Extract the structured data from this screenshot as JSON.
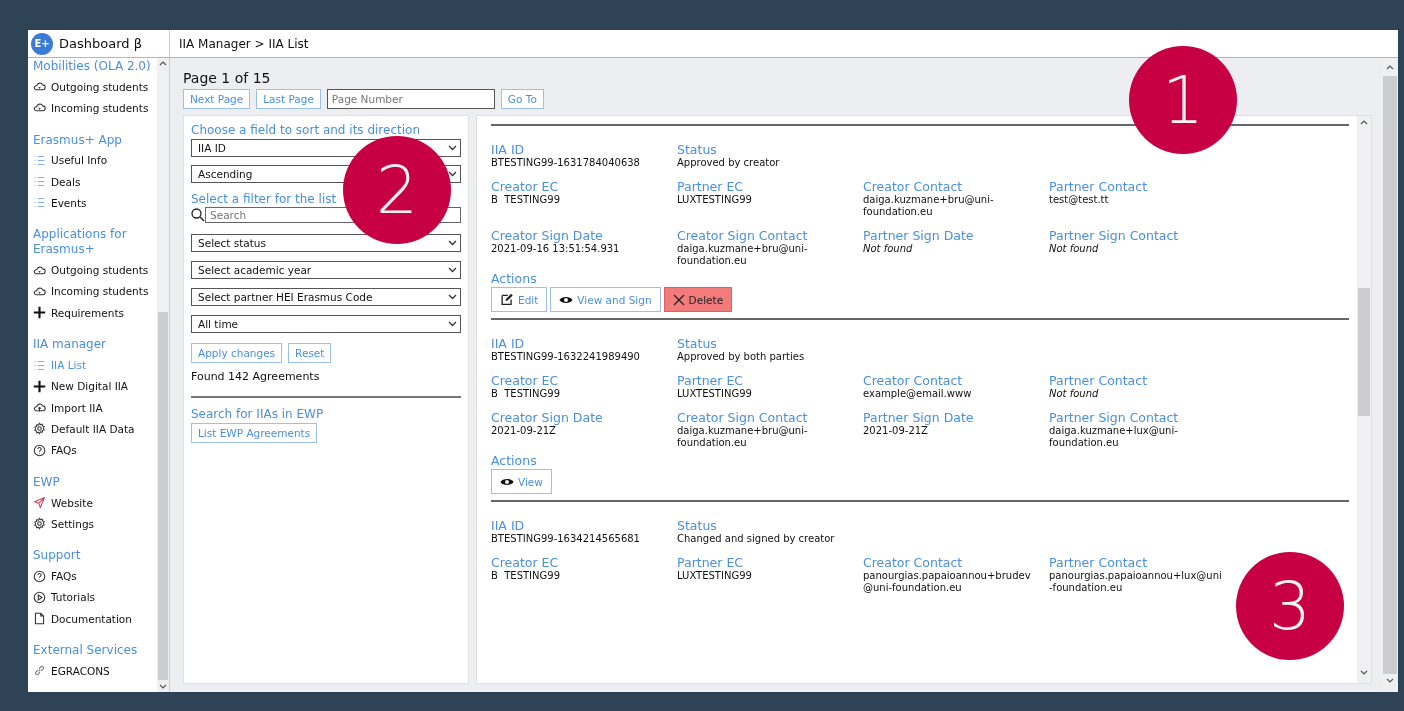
{
  "brand": {
    "logo": "E+",
    "title": "Dashboard β"
  },
  "breadcrumb": "IIA Manager > IIA List",
  "sidebar": {
    "sections": [
      {
        "heading": "Mobilities (OLA 2.0)",
        "items": [
          {
            "label": "Outgoing students",
            "kind": "cloud",
            "selected": false
          },
          {
            "label": "Incoming students",
            "kind": "cloud",
            "selected": false
          }
        ]
      },
      {
        "heading": "Erasmus+ App",
        "items": [
          {
            "label": "Useful Info",
            "kind": "list",
            "selected": false
          },
          {
            "label": "Deals",
            "kind": "list",
            "selected": false
          },
          {
            "label": "Events",
            "kind": "list",
            "selected": false
          }
        ]
      },
      {
        "heading": "Applications for Erasmus+",
        "items": [
          {
            "label": "Outgoing students",
            "kind": "cloud",
            "selected": false
          },
          {
            "label": "Incoming students",
            "kind": "cloud",
            "selected": false
          },
          {
            "label": "Requirements",
            "kind": "plus",
            "selected": false
          }
        ]
      },
      {
        "heading": "IIA manager",
        "items": [
          {
            "label": "IIA List",
            "kind": "list",
            "selected": true
          },
          {
            "label": "New Digital IIA",
            "kind": "plus",
            "selected": false
          },
          {
            "label": "Import IIA",
            "kind": "upload",
            "selected": false
          },
          {
            "label": "Default IIA Data",
            "kind": "gear",
            "selected": false
          },
          {
            "label": "FAQs",
            "kind": "question",
            "selected": false
          }
        ]
      },
      {
        "heading": "EWP",
        "items": [
          {
            "label": "Website",
            "kind": "send",
            "selected": false
          },
          {
            "label": "Settings",
            "kind": "gear",
            "selected": false
          }
        ]
      },
      {
        "heading": "Support",
        "items": [
          {
            "label": "FAQs",
            "kind": "question",
            "selected": false
          },
          {
            "label": "Tutorials",
            "kind": "play",
            "selected": false
          },
          {
            "label": "Documentation",
            "kind": "file",
            "selected": false
          }
        ]
      },
      {
        "heading": "External Services",
        "items": [
          {
            "label": "EGRACONS",
            "kind": "link",
            "selected": false
          }
        ]
      }
    ]
  },
  "pagination": {
    "title": "Page 1 of 15",
    "buttons": [
      "Next Page",
      "Last Page"
    ],
    "page_field": {
      "placeholder": "Page Number"
    },
    "go_button": "Go To"
  },
  "filters": {
    "sort_heading": "Choose a field to sort and its direction",
    "sort_selects": [
      "IIA ID",
      "Ascending"
    ],
    "filter_heading": "Select a filter for the list",
    "search": {
      "placeholder": "Search"
    },
    "filter_selects": [
      "Select status",
      "Select academic year",
      "Select partner HEI Erasmus Code",
      "All time"
    ],
    "buttons": [
      "Apply changes",
      "Reset"
    ],
    "found": "Found 142 Agreements",
    "ewp_heading": "Search for IIAs in EWP",
    "ewp_button": "List EWP Agreements"
  },
  "agreements": [
    {
      "rows": [
        [
          {
            "label": "IIA ID",
            "value": "BTESTING99-1631784040638",
            "missing": false
          },
          {
            "label": "Status",
            "value": "Approved by creator",
            "missing": false
          }
        ],
        [
          {
            "label": "Creator EC",
            "value": "B  TESTING99",
            "missing": false
          },
          {
            "label": "Partner EC",
            "value": "LUXTESTING99",
            "missing": false
          },
          {
            "label": "Creator Contact",
            "value": "daiga.kuzmane+bru@uni-foundation.eu",
            "missing": false
          },
          {
            "label": "Partner Contact",
            "value": "test@test.tt",
            "missing": false
          }
        ],
        [
          {
            "label": "Creator Sign Date",
            "value": "2021-09-16 13:51:54.931",
            "missing": false
          },
          {
            "label": "Creator Sign Contact",
            "value": "daiga.kuzmane+bru@uni-foundation.eu",
            "missing": false
          },
          {
            "label": "Partner Sign Date",
            "value": "Not found",
            "missing": true
          },
          {
            "label": "Partner Sign Contact",
            "value": "Not found",
            "missing": true
          }
        ]
      ],
      "actions_label": "Actions",
      "actions": [
        {
          "kind": "edit",
          "label": "Edit"
        },
        {
          "kind": "view",
          "label": "View and Sign"
        },
        {
          "kind": "delete",
          "label": "Delete"
        }
      ]
    },
    {
      "rows": [
        [
          {
            "label": "IIA ID",
            "value": "BTESTING99-1632241989490",
            "missing": false
          },
          {
            "label": "Status",
            "value": "Approved by both parties",
            "missing": false
          }
        ],
        [
          {
            "label": "Creator EC",
            "value": "B  TESTING99",
            "missing": false
          },
          {
            "label": "Partner EC",
            "value": "LUXTESTING99",
            "missing": false
          },
          {
            "label": "Creator Contact",
            "value": "example@email.www",
            "missing": false
          },
          {
            "label": "Partner Contact",
            "value": "Not found",
            "missing": true
          }
        ],
        [
          {
            "label": "Creator Sign Date",
            "value": "2021-09-21Z",
            "missing": false
          },
          {
            "label": "Creator Sign Contact",
            "value": "daiga.kuzmane+bru@uni-foundation.eu",
            "missing": false
          },
          {
            "label": "Partner Sign Date",
            "value": "2021-09-21Z",
            "missing": false
          },
          {
            "label": "Partner Sign Contact",
            "value": "daiga.kuzmane+lux@uni-foundation.eu",
            "missing": false
          }
        ]
      ],
      "actions_label": "Actions",
      "actions": [
        {
          "kind": "view",
          "label": "View"
        }
      ]
    },
    {
      "rows": [
        [
          {
            "label": "IIA ID",
            "value": "BTESTING99-1634214565681",
            "missing": false
          },
          {
            "label": "Status",
            "value": "Changed and signed by creator",
            "missing": false
          }
        ],
        [
          {
            "label": "Creator EC",
            "value": "B  TESTING99",
            "missing": false
          },
          {
            "label": "Partner EC",
            "value": "LUXTESTING99",
            "missing": false
          },
          {
            "label": "Creator Contact",
            "value": "panourgias.papaioannou+brudev@uni-foundation.eu",
            "missing": false
          },
          {
            "label": "Partner Contact",
            "value": "panourgias.papaioannou+lux@uni-foundation.eu",
            "missing": false
          }
        ]
      ]
    }
  ],
  "callouts": [
    "1",
    "2",
    "3"
  ]
}
